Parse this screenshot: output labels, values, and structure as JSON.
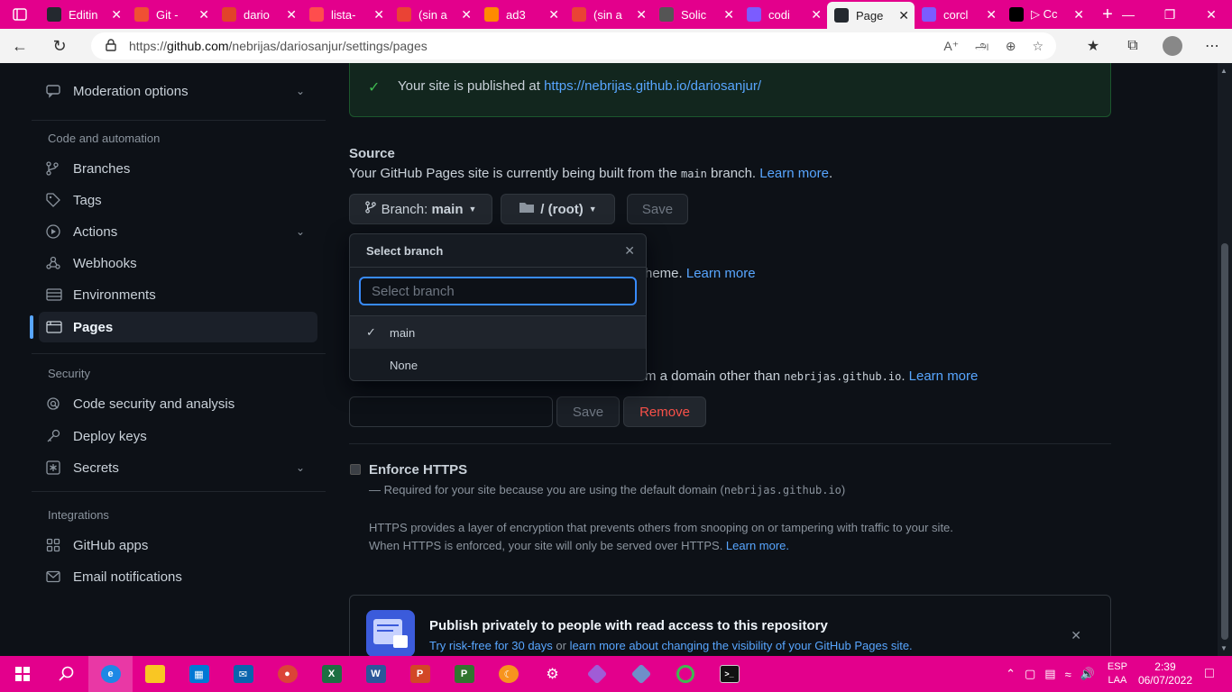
{
  "browser": {
    "tabs": [
      {
        "title": "Editin",
        "icon": "github-icon",
        "color": "#24292f"
      },
      {
        "title": "Git -",
        "icon": "git-icon",
        "color": "#f05033"
      },
      {
        "title": "dario",
        "icon": "arc-icon",
        "color": "#e24329"
      },
      {
        "title": "lista-",
        "icon": "document-icon",
        "color": "#ff4d4d"
      },
      {
        "title": "(sin a",
        "icon": "gmail-icon",
        "color": "#ea4335"
      },
      {
        "title": "ad3",
        "icon": "book-icon",
        "color": "#ff8a00"
      },
      {
        "title": "(sin a",
        "icon": "gmail-icon",
        "color": "#ea4335"
      },
      {
        "title": "Solic",
        "icon": "form-icon",
        "color": "#555555"
      },
      {
        "title": "codi",
        "icon": "search-icon",
        "color": "#7b5cff"
      },
      {
        "title": "Page",
        "icon": "github-icon",
        "color": "#24292f"
      },
      {
        "title": "corcl",
        "icon": "search-icon",
        "color": "#7b5cff"
      },
      {
        "title": "▷ Cc",
        "icon": "tiktok-icon",
        "color": "#000000"
      }
    ],
    "active_tab_index": 9,
    "url_scheme": "https://",
    "url_host": "github.com",
    "url_path": "/nebrijas/dariosanjur/settings/pages"
  },
  "sidebar": {
    "items_top": [
      {
        "label": "Moderation options",
        "icon": "comment-icon",
        "expandable": true
      }
    ],
    "sections": [
      {
        "heading": "Code and automation",
        "items": [
          {
            "label": "Branches",
            "icon": "branch-icon",
            "expandable": false
          },
          {
            "label": "Tags",
            "icon": "tag-icon",
            "expandable": false
          },
          {
            "label": "Actions",
            "icon": "play-icon",
            "expandable": true
          },
          {
            "label": "Webhooks",
            "icon": "webhook-icon",
            "expandable": false
          },
          {
            "label": "Environments",
            "icon": "server-icon",
            "expandable": false
          },
          {
            "label": "Pages",
            "icon": "browser-icon",
            "expandable": false,
            "active": true
          }
        ]
      },
      {
        "heading": "Security",
        "items": [
          {
            "label": "Code security and analysis",
            "icon": "shield-search-icon",
            "expandable": false
          },
          {
            "label": "Deploy keys",
            "icon": "key-icon",
            "expandable": false
          },
          {
            "label": "Secrets",
            "icon": "asterisk-icon",
            "expandable": true
          }
        ]
      },
      {
        "heading": "Integrations",
        "items": [
          {
            "label": "GitHub apps",
            "icon": "apps-icon",
            "expandable": false
          },
          {
            "label": "Email notifications",
            "icon": "mail-icon",
            "expandable": false
          }
        ]
      }
    ]
  },
  "main": {
    "flash": {
      "text": "Your site is published at ",
      "link": "https://nebrijas.github.io/dariosanjur/"
    },
    "source": {
      "title": "Source",
      "text_before": "Your GitHub Pages site is currently being built from the ",
      "branch_code": "main",
      "text_after": " branch. ",
      "learn_more": "Learn more"
    },
    "branch_button": {
      "prefix": "Branch: ",
      "value": "main"
    },
    "folder_button": "/ (root)",
    "save_label": "Save",
    "theme_fragment": "heme. ",
    "theme_learn_more": "Learn more",
    "domain_fragment": "m a domain other than ",
    "domain_code": "nebrijas.github.io",
    "domain_suffix": ". ",
    "domain_learn_more": "Learn more",
    "domain_save": "Save",
    "domain_remove": "Remove",
    "https": {
      "title": "Enforce HTTPS",
      "note_before": "— Required for your site because you are using the default domain (",
      "note_code": "nebrijas.github.io",
      "note_after": ")",
      "desc1": "HTTPS provides a layer of encryption that prevents others from snooping on or tampering with traffic to your site.",
      "desc2": "When HTTPS is enforced, your site will only be served over HTTPS. ",
      "desc2_link": "Learn more."
    },
    "promo": {
      "title": "Publish privately to people with read access to this repository",
      "link1": "Try risk-free for 30 days",
      "mid": " or ",
      "link2": "learn more about changing the visibility of your GitHub Pages site."
    }
  },
  "dropdown": {
    "title": "Select branch",
    "placeholder": "Select branch",
    "options": [
      {
        "label": "main",
        "selected": true
      },
      {
        "label": "None",
        "selected": false
      }
    ]
  },
  "taskbar": {
    "apps": [
      "windows-icon",
      "search-icon",
      "edge-icon",
      "explorer-icon",
      "store-icon",
      "mail-icon",
      "chrome-icon",
      "excel-icon",
      "word-icon",
      "powerpoint-icon",
      "project-icon",
      "eclipse-icon",
      "settings-icon",
      "git-icon",
      "git-gui-icon",
      "spinner-icon",
      "terminal-icon"
    ],
    "lang_line1": "ESP",
    "lang_line2": "LAA",
    "time": "2:39",
    "date": "06/07/2022"
  }
}
